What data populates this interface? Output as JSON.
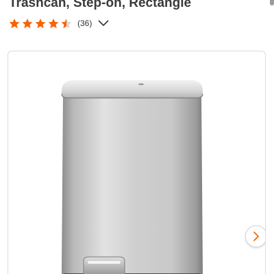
{
  "product": {
    "title": "Trashcan, Step-on, Rectangle"
  },
  "rating": {
    "stars": 4.5,
    "max_stars": 5,
    "review_count": "(36)",
    "star_color": "#f96302",
    "expand_icon": "chevron-down-icon"
  },
  "gallery": {
    "next_icon": "chevron-right-icon",
    "accent_color": "#f96302"
  }
}
